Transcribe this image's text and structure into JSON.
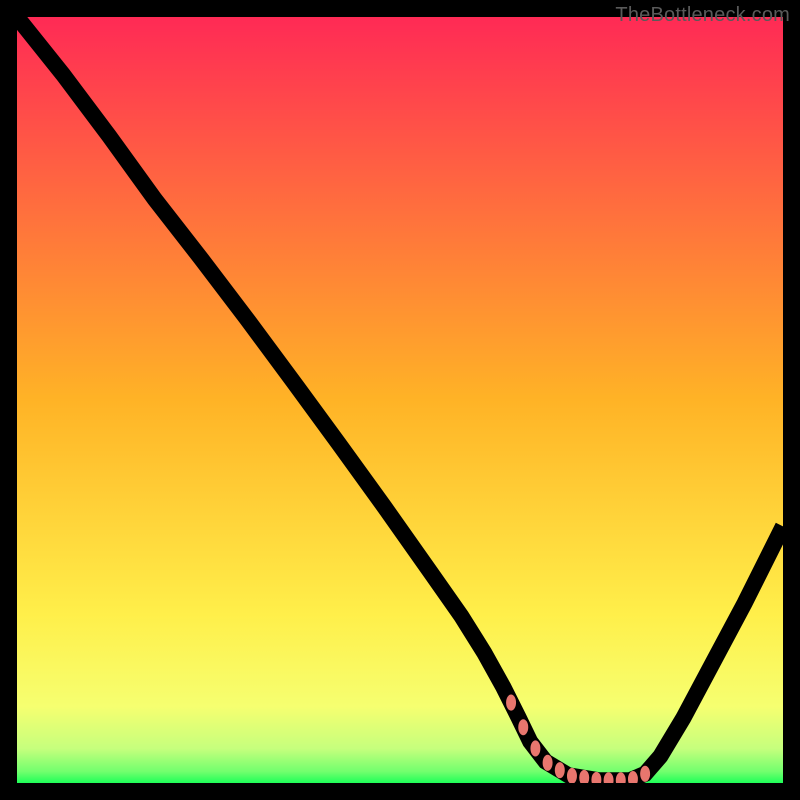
{
  "watermark": "TheBottleneck.com",
  "chart_data": {
    "type": "line",
    "title": "",
    "xlabel": "",
    "ylabel": "",
    "xlim": [
      0,
      100
    ],
    "ylim": [
      0,
      100
    ],
    "grid": false,
    "series": [
      {
        "name": "curve",
        "x": [
          0,
          6,
          12,
          18,
          24,
          30,
          36,
          42,
          48,
          54,
          58,
          61,
          63.5,
          65.5,
          67,
          69,
          72,
          76,
          80,
          82,
          84,
          87,
          91,
          95,
          100
        ],
        "y": [
          100,
          92.5,
          84.5,
          76.2,
          68.5,
          60.6,
          52.5,
          44.3,
          36.0,
          27.5,
          21.8,
          17.0,
          12.5,
          8.5,
          5.4,
          2.8,
          1.0,
          0.35,
          0.35,
          1.2,
          3.5,
          8.5,
          16.0,
          23.5,
          33.5
        ]
      }
    ],
    "markers": {
      "name": "red-dots",
      "x_range": [
        64.5,
        82.0
      ],
      "count": 12,
      "y_note": "along valley floor and lower walls"
    },
    "background": {
      "type": "vertical-gradient",
      "stops": [
        {
          "pos": 0.0,
          "color": "#ff2a55"
        },
        {
          "pos": 0.5,
          "color": "#ffb326"
        },
        {
          "pos": 0.78,
          "color": "#ffef4a"
        },
        {
          "pos": 0.9,
          "color": "#f6ff70"
        },
        {
          "pos": 0.955,
          "color": "#c6ff7d"
        },
        {
          "pos": 0.985,
          "color": "#72ff6e"
        },
        {
          "pos": 1.0,
          "color": "#1eff58"
        }
      ]
    }
  }
}
